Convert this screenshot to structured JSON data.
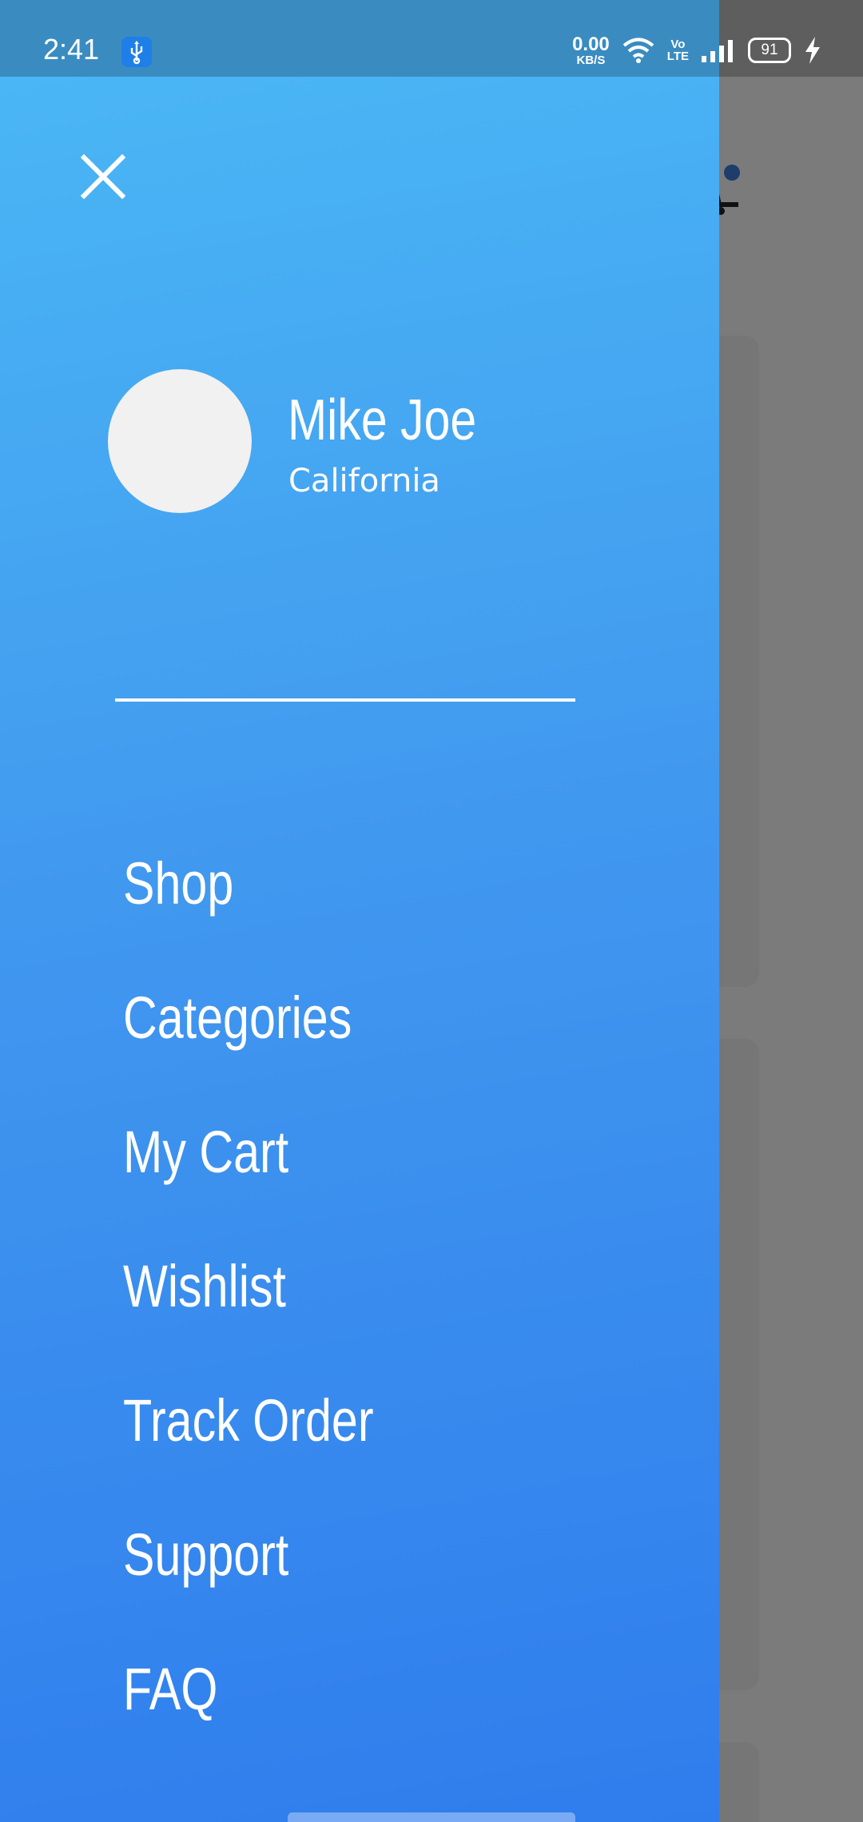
{
  "status_bar": {
    "time": "2:41",
    "net_speed_value": "0.00",
    "net_speed_unit": "KB/S",
    "volte_top": "Vo",
    "volte_bottom": "LTE",
    "battery_level": "91",
    "icons": [
      "usb-icon",
      "wifi-icon",
      "signal-icon",
      "battery-icon",
      "charging-icon"
    ]
  },
  "drawer": {
    "close_icon": "close-icon",
    "profile": {
      "name": "Mike Joe",
      "location": "California"
    },
    "menu": [
      {
        "label": "Shop"
      },
      {
        "label": "Categories"
      },
      {
        "label": "My Cart"
      },
      {
        "label": "Wishlist"
      },
      {
        "label": "Track Order"
      },
      {
        "label": "Support"
      },
      {
        "label": "FAQ"
      }
    ]
  },
  "colors": {
    "drawer_top": "#4ab6f5",
    "drawer_bottom": "#2f7ded",
    "text": "#ffffff",
    "scrim": "#7a7a7a",
    "avatar": "#f1f1f1"
  }
}
